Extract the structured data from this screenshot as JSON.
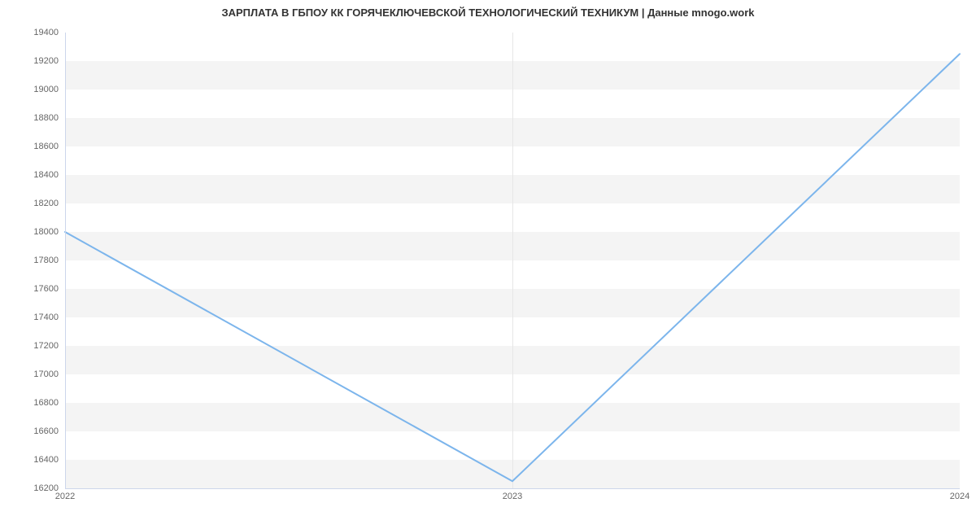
{
  "chart_data": {
    "type": "line",
    "title": "ЗАРПЛАТА В ГБПОУ КК ГОРЯЧЕКЛЮЧЕВСКОЙ ТЕХНОЛОГИЧЕСКИЙ ТЕХНИКУМ | Данные mnogo.work",
    "xlabel": "",
    "ylabel": "",
    "x": [
      "2022",
      "2023",
      "2024"
    ],
    "values": [
      18000,
      16250,
      19250
    ],
    "y_ticks": [
      16200,
      16400,
      16600,
      16800,
      17000,
      17200,
      17400,
      17600,
      17800,
      18000,
      18200,
      18400,
      18600,
      18800,
      19000,
      19200,
      19400
    ],
    "ylim": [
      16200,
      19400
    ],
    "line_color": "#7cb5ec"
  }
}
